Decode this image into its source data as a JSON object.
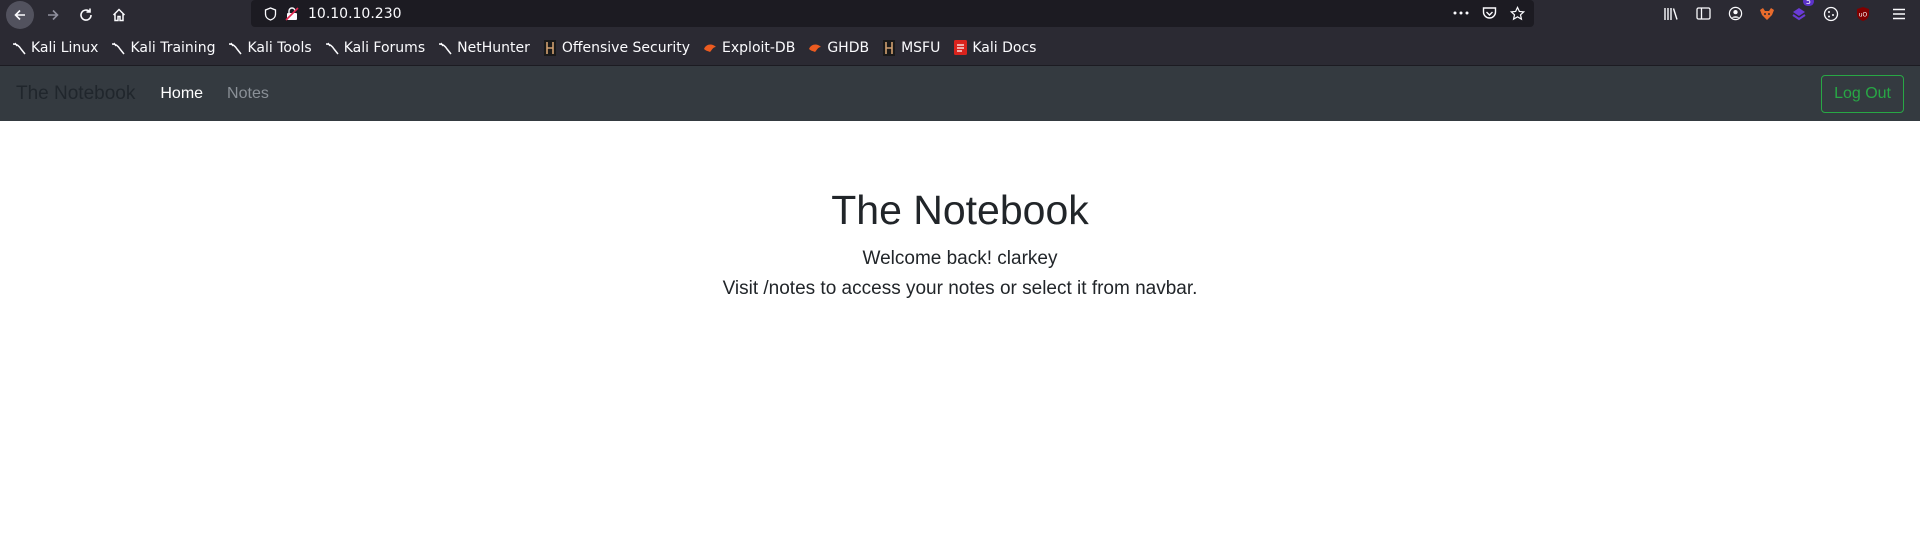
{
  "browser": {
    "url": "10.10.10.230",
    "extension_badge": "5",
    "bookmarks": [
      {
        "label": "Kali Linux",
        "icon": "kali-dragon-icon"
      },
      {
        "label": "Kali Training",
        "icon": "kali-dragon-icon"
      },
      {
        "label": "Kali Tools",
        "icon": "kali-dragon-icon"
      },
      {
        "label": "Kali Forums",
        "icon": "kali-dragon-icon"
      },
      {
        "label": "NetHunter",
        "icon": "kali-dragon-icon"
      },
      {
        "label": "Offensive Security",
        "icon": "offsec-icon"
      },
      {
        "label": "Exploit-DB",
        "icon": "exploitdb-icon"
      },
      {
        "label": "GHDB",
        "icon": "exploitdb-icon"
      },
      {
        "label": "MSFU",
        "icon": "offsec-icon"
      },
      {
        "label": "Kali Docs",
        "icon": "kali-docs-icon"
      }
    ]
  },
  "site": {
    "brand": "The Notebook",
    "nav": {
      "home": "Home",
      "notes": "Notes"
    },
    "logout_label": "Log Out",
    "colors": {
      "navbar": "#343a40",
      "logout": "#28a745"
    }
  },
  "main": {
    "title": "The Notebook",
    "welcome": "Welcome back! clarkey",
    "hint": "Visit /notes to access your notes or select it from navbar."
  }
}
